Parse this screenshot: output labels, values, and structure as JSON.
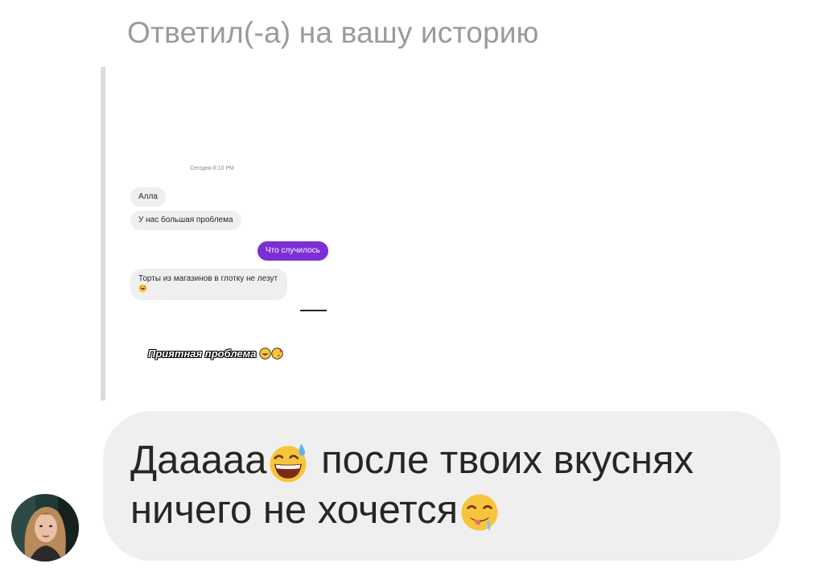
{
  "reply": {
    "header": "Ответил(-а) на вашу историю"
  },
  "story": {
    "timestamp": "Сегодня 8:10 PM",
    "messages": [
      {
        "direction": "incoming",
        "text": "Алла"
      },
      {
        "direction": "incoming",
        "text": "У нас большая проблема"
      },
      {
        "direction": "outgoing",
        "text": "Что случилось"
      },
      {
        "direction": "incoming",
        "text": "Торты из магазинов в глотку не лезут"
      }
    ],
    "caption": "Приятная проблема",
    "outgoing_bubble_color": "#7b2fd4"
  },
  "message": {
    "part1": "Дааааа",
    "part2": " после твоих вкуснях ничего не хочется",
    "emoji1": "grinning-face-with-sweat",
    "emoji2": "drooling-face",
    "bubble_color": "#efefef"
  },
  "sender": {
    "avatar_icon": "user-avatar"
  }
}
